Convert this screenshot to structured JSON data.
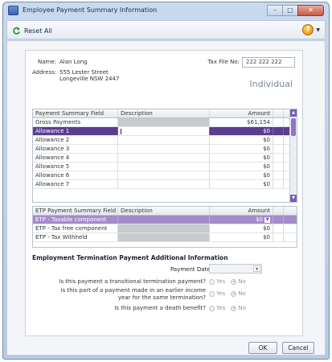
{
  "window": {
    "title": "Employee Payment Summary Information"
  },
  "toolbar": {
    "reset_label": "Reset All"
  },
  "employee": {
    "name_label": "Name:",
    "name": "Alan Long",
    "address_label": "Address:",
    "address_line1": "555 Lester Street",
    "address_line2": "Longeville NSW 2447",
    "tax_file_label": "Tax File No:",
    "tax_file_value": "222 222 222",
    "type": "Individual"
  },
  "payment_grid": {
    "headers": [
      "Payment Summary Field",
      "Description",
      "Amount"
    ],
    "rows": [
      {
        "field": "Gross Payments",
        "description": "",
        "amount": "$61,154"
      },
      {
        "field": "Allowance 1",
        "description": "",
        "amount": "$0"
      },
      {
        "field": "Allowance 2",
        "description": "",
        "amount": "$0"
      },
      {
        "field": "Allowance 3",
        "description": "",
        "amount": "$0"
      },
      {
        "field": "Allowance 4",
        "description": "",
        "amount": "$0"
      },
      {
        "field": "Allowance 5",
        "description": "",
        "amount": "$0"
      },
      {
        "field": "Allowance 6",
        "description": "",
        "amount": "$0"
      },
      {
        "field": "Allowance 7",
        "description": "",
        "amount": "$0"
      }
    ]
  },
  "etp_grid": {
    "headers": [
      "ETP Payment Summary Field",
      "Description",
      "Amount"
    ],
    "rows": [
      {
        "field": "ETP - Taxable component",
        "description": "",
        "amount": "$0"
      },
      {
        "field": "ETP - Tax free component",
        "description": "",
        "amount": "$0"
      },
      {
        "field": "ETP - Tax Withheld",
        "description": "",
        "amount": "$0"
      }
    ]
  },
  "etp_info": {
    "title": "Employment Termination Payment Additional Information",
    "payment_date_label": "Payment Date:",
    "payment_date_value": "",
    "q1": "Is this payment a transitional termination payment?",
    "q2_line1": "Is this part of a payment made in an earlier income",
    "q2_line2": "year for the same termination?",
    "q3": "Is this payment a death benefit?",
    "yes_label": "Yes",
    "no_label": "No",
    "q1_answer": "No",
    "q2_answer": "No",
    "q3_answer": "No"
  },
  "buttons": {
    "ok": "OK",
    "cancel": "Cancel"
  }
}
